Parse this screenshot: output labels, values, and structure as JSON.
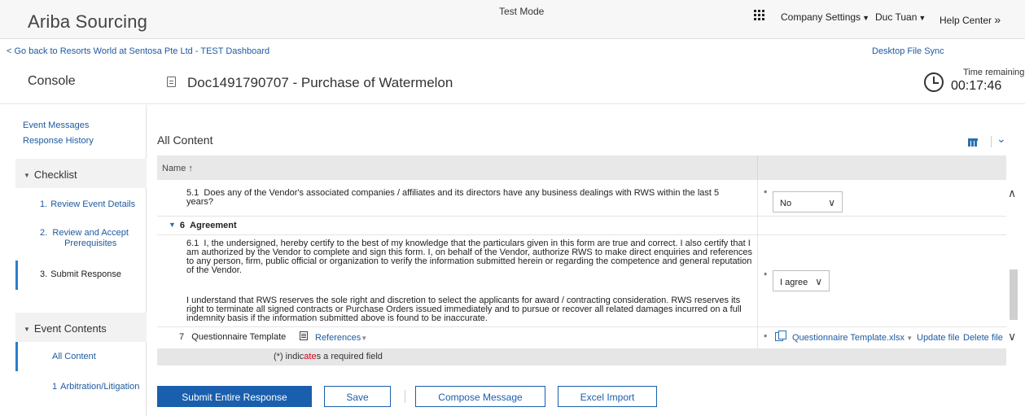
{
  "header": {
    "brand": "Ariba Sourcing",
    "test_mode": "Test Mode",
    "company_settings": "Company Settings",
    "user": "Duc Tuan",
    "help_center": "Help Center",
    "help_chevron": "»"
  },
  "subbar": {
    "back_link": "< Go back to Resorts World at Sentosa Pte Ltd - TEST Dashboard",
    "desktop_sync": "Desktop File Sync"
  },
  "titlebar": {
    "console": "Console",
    "doc_title": "Doc1491790707 - Purchase of Watermelon",
    "time_label": "Time remaining",
    "time_value": "00:17:46"
  },
  "sidebar": {
    "event_messages": "Event Messages",
    "response_history": "Response History",
    "checklist": {
      "label": "Checklist",
      "items": [
        {
          "num": "1.",
          "label": "Review Event Details"
        },
        {
          "num": "2.",
          "label": "Review and Accept Prerequisites"
        },
        {
          "num": "3.",
          "label": "Submit Response"
        }
      ]
    },
    "event_contents": {
      "label": "Event Contents",
      "items": [
        {
          "label": "All Content"
        },
        {
          "num": "1",
          "label": "Arbitration/Litigation"
        }
      ]
    }
  },
  "content": {
    "title": "All Content",
    "column_name": "Name",
    "sort_indicator": "↑",
    "rows": {
      "q51_num": "5.1",
      "q51_text": "Does any of the Vendor's associated companies / affiliates and its directors have any business dealings with RWS within the last 5 years?",
      "q51_value": "No",
      "section6_num": "6",
      "section6_label": "Agreement",
      "q61_num": "6.1",
      "q61_text_1": "I, the undersigned, hereby certify to the best of my knowledge that the particulars given in this form are true and correct. I also certify that I am authorized by the Vendor to complete and sign this form. I, on behalf of the Vendor, authorize RWS to make direct enquiries and references to any person, firm, public official or organization to verify the information submitted herein or regarding the competence and general reputation of the Vendor.",
      "q61_text_2": "I understand that RWS reserves the sole right and discretion to select the applicants for award / contracting consideration. RWS reserves its right to terminate all signed contracts or Purchase Orders issued immediately and to pursue or recover all related damages incurred on a full indemnity basis if the information submitted above is found to be inaccurate.",
      "q61_value": "I agree",
      "q7_num": "7",
      "q7_label": "Questionnaire Template",
      "references": "References",
      "file_name": "Questionnaire Template.xlsx",
      "update_file": "Update file",
      "delete_file": "Delete file",
      "required_mark": "*"
    },
    "footnote_prefix": "(*) indic",
    "footnote_mid": "ate",
    "footnote_suffix": "s a required field"
  },
  "buttons": {
    "submit": "Submit Entire Response",
    "save": "Save",
    "compose": "Compose Message",
    "excel": "Excel Import"
  },
  "colors": {
    "link": "#1f5aa0",
    "primary": "#1a5fad",
    "required_red": "#d0021b"
  }
}
